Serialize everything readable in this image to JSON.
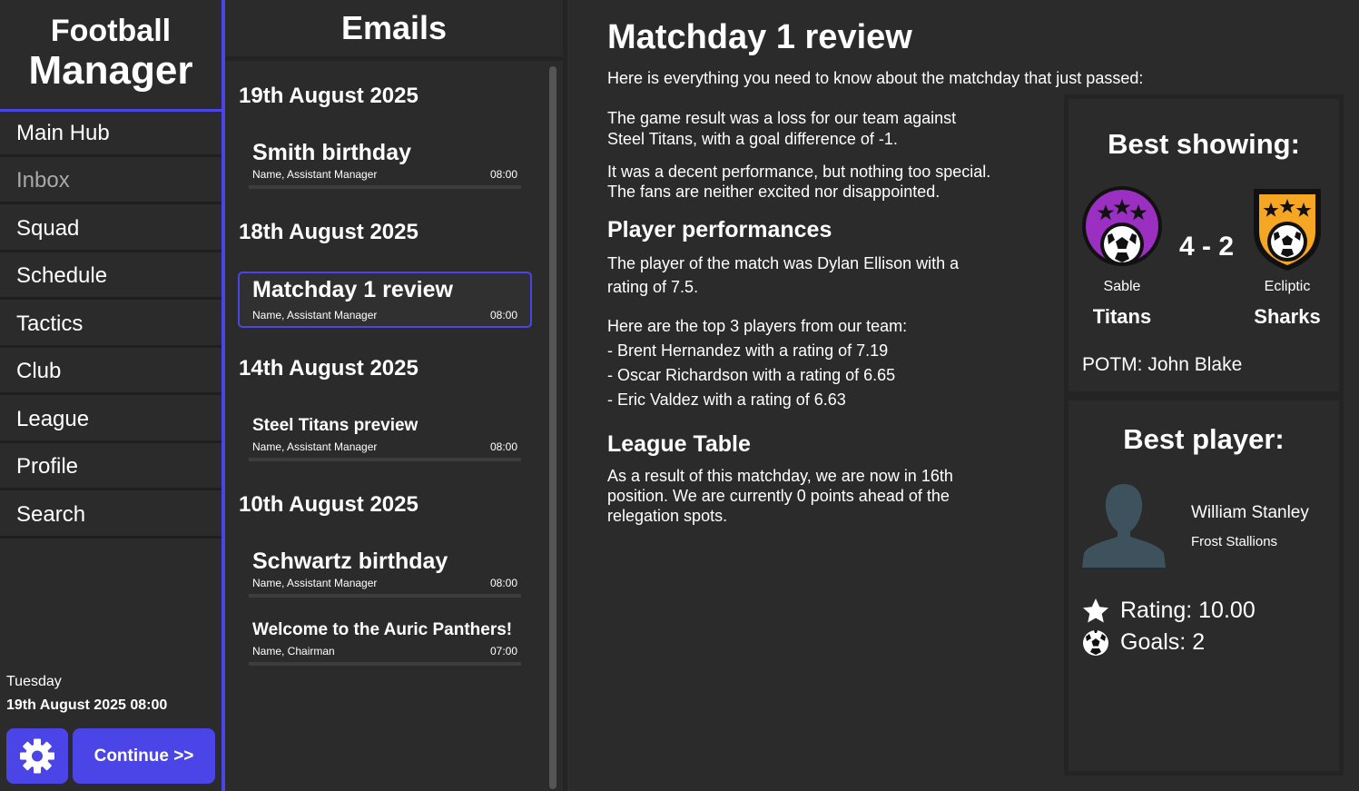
{
  "app": {
    "title_line1": "Football",
    "title_line2": "Manager"
  },
  "sidebar": {
    "items": [
      {
        "label": "Main Hub"
      },
      {
        "label": "Inbox"
      },
      {
        "label": "Squad"
      },
      {
        "label": "Schedule"
      },
      {
        "label": "Tactics"
      },
      {
        "label": "Club"
      },
      {
        "label": "League"
      },
      {
        "label": "Profile"
      },
      {
        "label": "Search"
      }
    ],
    "active": "Inbox",
    "day": "Tuesday",
    "datetime": "19th August 2025 08:00",
    "continue_label": "Continue >>",
    "settings_icon": "gear-icon"
  },
  "emails": {
    "header": "Emails",
    "groups": [
      {
        "date": "19th August 2025",
        "items": [
          {
            "subject": "Smith birthday",
            "sender": "Name, Assistant Manager",
            "time": "08:00"
          }
        ]
      },
      {
        "date": "18th August 2025",
        "items": [
          {
            "subject": "Matchday 1 review",
            "sender": "Name, Assistant Manager",
            "time": "08:00",
            "selected": true
          }
        ]
      },
      {
        "date": "14th August 2025",
        "items": [
          {
            "subject": "Steel Titans preview",
            "sender": "Name, Assistant Manager",
            "time": "08:00"
          }
        ]
      },
      {
        "date": "10th August 2025",
        "items": [
          {
            "subject": "Schwartz birthday",
            "sender": "Name, Assistant Manager",
            "time": "08:00"
          },
          {
            "subject": "Welcome to the Auric Panthers!",
            "sender": "Name, Chairman",
            "time": "07:00"
          }
        ]
      }
    ]
  },
  "main": {
    "title": "Matchday 1 review",
    "intro": "Here is everything you need to know about the matchday that just passed:",
    "result_line1": "The game result was a loss for our team against",
    "result_line2": "Steel Titans, with a goal difference of -1.",
    "perf_line1": "It was a decent performance, but nothing too special.",
    "perf_line2": "The fans are neither excited nor disappointed.",
    "player_heading": "Player performances",
    "potm_line1": "The player of the match was Dylan Ellison with a",
    "potm_line2": "rating of 7.5.",
    "top3_intro": "Here are the top 3 players from our team:",
    "top3": [
      "- Brent Hernandez with a rating of 7.19",
      "- Oscar Richardson with a rating of 6.65",
      "- Eric Valdez with a rating of 6.63"
    ],
    "league_heading": "League Table",
    "league_line1": "As a result of this matchday, we are now in 16th",
    "league_line2": "position. We are currently 0 points ahead of the",
    "league_line3": "relegation spots."
  },
  "best_showing": {
    "title": "Best showing:",
    "home_top": "Sable",
    "home_bottom": "Titans",
    "home_color": "#9b2fc2",
    "away_top": "Ecliptic",
    "away_bottom": "Sharks",
    "away_color": "#f5a623",
    "score": "4 - 2",
    "potm_label": "POTM: ",
    "potm_name": "John Blake"
  },
  "best_player": {
    "title": "Best player:",
    "name": "William Stanley",
    "club": "Frost Stallions",
    "rating_label": "Rating: 10.00",
    "goals_label": "Goals: 2",
    "avatar_icon": "person-silhouette-icon"
  },
  "colors": {
    "accent": "#4b44e6",
    "background": "#2b2b2b",
    "muted_text": "#a9a9a9"
  }
}
